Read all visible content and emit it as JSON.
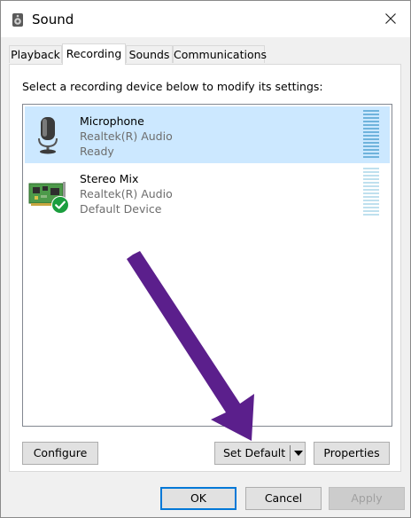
{
  "window": {
    "title": "Sound"
  },
  "tabs": [
    {
      "label": "Playback"
    },
    {
      "label": "Recording"
    },
    {
      "label": "Sounds"
    },
    {
      "label": "Communications"
    }
  ],
  "active_tab": "Recording",
  "panel": {
    "instruction": "Select a recording device below to modify its settings:"
  },
  "devices": [
    {
      "name": "Microphone",
      "driver": "Realtek(R) Audio",
      "status": "Ready",
      "selected": true,
      "icon": "microphone-icon",
      "meter_color": "#6fb3dc"
    },
    {
      "name": "Stereo Mix",
      "driver": "Realtek(R) Audio",
      "status": "Default Device",
      "selected": false,
      "icon": "sound-card-icon",
      "badge": "default-check-icon",
      "meter_color": "#bfe0ee"
    }
  ],
  "panel_buttons": {
    "configure": "Configure",
    "set_default": "Set Default",
    "properties": "Properties"
  },
  "dialog_buttons": {
    "ok": "OK",
    "cancel": "Cancel",
    "apply": "Apply"
  },
  "colors": {
    "selection": "#cce8ff",
    "accent": "#0078d7",
    "arrow": "#5b1f8c",
    "check_badge": "#1b9e3e"
  }
}
